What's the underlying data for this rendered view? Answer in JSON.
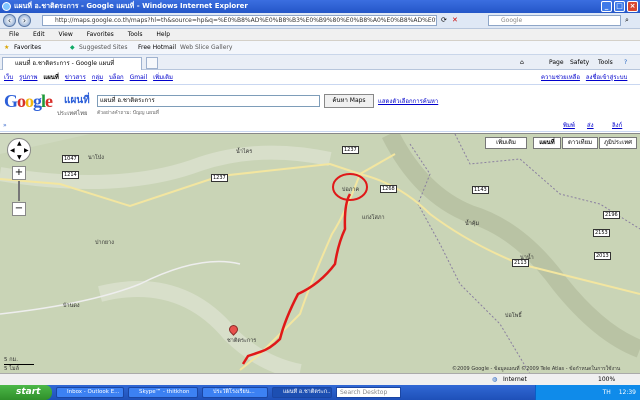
{
  "window": {
    "title": "แผนที่ อ.ชาติตระการ - Google แผนที่ - Windows Internet Explorer"
  },
  "address": {
    "url": "http://maps.google.co.th/maps?hl=th&source=hp&q=%E0%B8%AD%E0%B8%B3%E0%B9%80%E0%B8%A0%E0%B8%AD%E0%B8%8A%E0%B8%B2%E0%B8%95%E0%B8%B4%E0%B8%95%E0%B8%A3%E0%B8%B0%E0%B8%81%E0%B8%B2%E0%B8%A3",
    "search_placeholder": "Google"
  },
  "menu": [
    "File",
    "Edit",
    "View",
    "Favorites",
    "Tools",
    "Help"
  ],
  "favorites": {
    "label": "Favorites",
    "items": [
      "Suggested Sites",
      "Free Hotmail",
      "Web Slice Gallery"
    ]
  },
  "tab": {
    "label": "แผนที่ อ.ชาติตระการ - Google แผนที่"
  },
  "toolbar_right": [
    "Page",
    "Safety",
    "Tools"
  ],
  "gbar": {
    "links": [
      "เว็บ",
      "รูปภาพ",
      "แผนที่",
      "ข่าวสาร",
      "กลุ่ม",
      "บล็อก",
      "Gmail",
      "เพิ่มเติม"
    ],
    "right": [
      "ความช่วยเหลือ",
      "ลงชื่อเข้าสู่ระบบ"
    ]
  },
  "logo": {
    "google": "Google",
    "product": "แผนที่",
    "country": "ประเทศไทย"
  },
  "search": {
    "query": "แผนที่ อ.ชาติตระการ",
    "button": "ค้นหา Maps",
    "options": "แสดงตัวเลือกการค้นหา",
    "hint": "ตัวอย่างคำถาม: ปัญญ แผนที่",
    "chevrons": "»"
  },
  "strip": {
    "links": [
      "พิมพ์",
      "ส่ง",
      "ลิงก์"
    ]
  },
  "map": {
    "buttons": [
      "เพิ่มเติม",
      "แผนที่",
      "ดาวเทียม",
      "ภูมิประเทศ"
    ],
    "places": [
      "นาโป่ง",
      "น้ำไคร",
      "บ่อภาค",
      "แก่งโสภา",
      "ชาติตระการ",
      "ปากยาง",
      "บ้านดง",
      "น้ำคุ้ม",
      "นาน้ำ",
      "บ่อโพธิ์"
    ],
    "roads": [
      "1047",
      "1214",
      "1237",
      "1268",
      "1143",
      "1237",
      "2113",
      "2013",
      "2153",
      "2196"
    ],
    "scale": [
      "5 กม.",
      "5 ไมล์"
    ],
    "copyright": "©2009 Google - ข้อมูลแผนที่ ©2009 Tele Atlas - ข้อกำหนดในการใช้งาน",
    "route_color": "#e01818"
  },
  "status": {
    "zone": "Internet",
    "zoom": "100%"
  },
  "taskbar": {
    "start": "start",
    "items": [
      "Inbox - Outlook E...",
      "Skype™ - thitkhon",
      "ประวัติโรงเรียน...",
      "แผนที่ อ.ชาติตระก..."
    ],
    "search": "Search Desktop",
    "time": "12:39",
    "lang": "TH"
  }
}
